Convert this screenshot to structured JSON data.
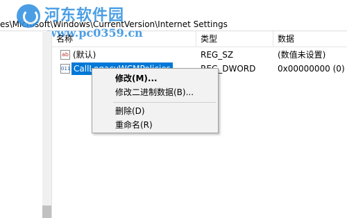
{
  "path": "es\\Microsoft\\Windows\\CurrentVersion\\Internet Settings",
  "watermark": {
    "title": "河东软件园",
    "url": "www.pc0359.cn"
  },
  "columns": [
    "名称",
    "类型",
    "数据"
  ],
  "rows": [
    {
      "name": "(默认)",
      "type": "REG_SZ",
      "data": "(数值未设置)",
      "icon": "string-value-icon"
    },
    {
      "name": "CallLegacyWCMPolicies",
      "type": "REG_DWORD",
      "data": "0x00000000 (0)",
      "icon": "binary-value-icon"
    }
  ],
  "icons": {
    "string": "ab",
    "binary": "011"
  },
  "context_menu": {
    "items": [
      "修改(M)...",
      "修改二进制数据(B)...",
      "删除(D)",
      "重命名(R)"
    ]
  },
  "colors": {
    "selection": "#0078d7",
    "watermark": "#2c8ee0",
    "menu_bg": "#f2f2f2"
  }
}
